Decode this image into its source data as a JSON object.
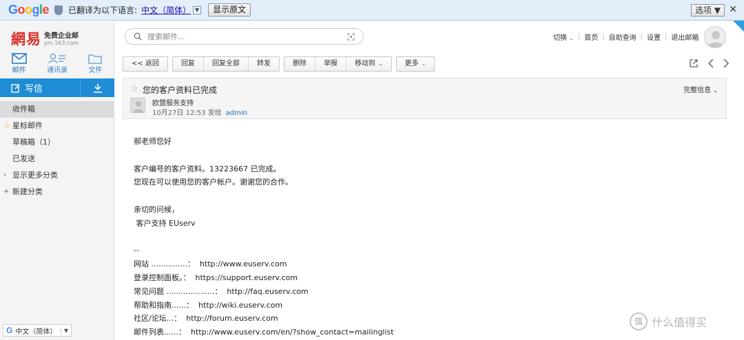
{
  "translate_bar": {
    "logo": "Google",
    "message": "已翻译为以下语言:",
    "language": "中文（简体）",
    "show_original": "显示原文",
    "options": "选项",
    "close": "✕"
  },
  "sidebar": {
    "logo_cn": "網易",
    "logo_title": "免费企业邮",
    "logo_domain": "ym.163.com",
    "nav": [
      {
        "label": "邮件",
        "icon": "mail-icon"
      },
      {
        "label": "通讯录",
        "icon": "contacts-icon"
      },
      {
        "label": "文件",
        "icon": "folder-icon"
      }
    ],
    "compose_label": "写信",
    "folders": [
      {
        "label": "收件箱",
        "prefix": ""
      },
      {
        "label": "星标邮件",
        "prefix": "☆"
      },
      {
        "label": "草稿箱（1）",
        "prefix": ""
      },
      {
        "label": "已发送",
        "prefix": ""
      },
      {
        "label": "显示更多分类",
        "prefix": "›"
      },
      {
        "label": "新建分类",
        "prefix": "+"
      }
    ],
    "google_widget": {
      "logo": "G",
      "language": "中文（简体）"
    }
  },
  "header": {
    "search_placeholder": "搜索邮件...",
    "links": [
      "切换",
      "首页",
      "自助查询",
      "设置",
      "退出邮箱"
    ]
  },
  "toolbar": {
    "back": "<< 返回",
    "reply": "回复",
    "reply_all": "回复全部",
    "forward": "转发",
    "delete": "删除",
    "report": "举报",
    "move_to": "移动到",
    "more": "更多"
  },
  "message": {
    "subject": "您的客户资料已完成",
    "more_info": "完整信息",
    "sender": "欧盟服务支持",
    "date": "10月27日 12:53 发给",
    "to": "admin",
    "body_lines": [
      "郝老师您好",
      "",
      "客户编号的客户资料。13223667 已完成。",
      "您现在可以使用您的客户帐户。谢谢您的合作。",
      "",
      "亲切的问候，",
      " 客户支持 EUserv",
      "",
      "--",
      "网站 ...............：  http://www.euserv.com",
      "登录控制面板。：  https://support.euserv.com",
      "常见问题 ....................：  http://faq.euserv.com",
      "帮助和指南......：  http://wiki.euserv.com",
      "社区/论坛...：  http://forum.euserv.com",
      "邮件列表......：  http://www.euserv.com/en/?show_contact=mailinglist"
    ]
  },
  "watermark": {
    "badge": "值",
    "text": "什么值得买"
  },
  "colors": {
    "accent": "#1f8dd6",
    "logo_red": "#d9302b",
    "translate_bar": "#e4eefb"
  }
}
